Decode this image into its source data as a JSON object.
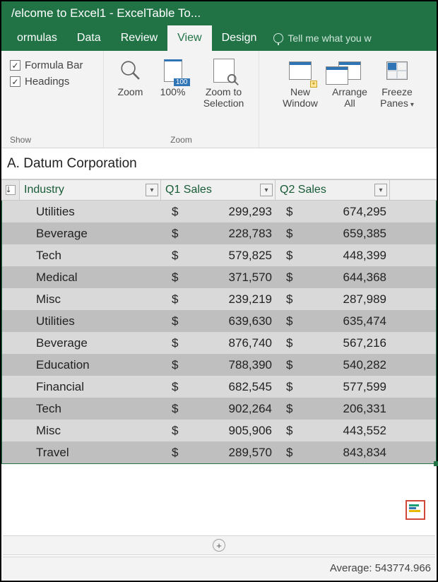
{
  "title": "/elcome to Excel1 - Excel",
  "context_tab": "Table To...",
  "tabs": {
    "formulas": "ormulas",
    "data": "Data",
    "review": "Review",
    "view": "View",
    "design": "Design"
  },
  "tellme": "Tell me what you w",
  "ribbon": {
    "show": {
      "formula_bar": "Formula Bar",
      "headings": "Headings",
      "group": "Show"
    },
    "zoom": {
      "zoom": "Zoom",
      "hundred": "100%",
      "toselection_l1": "Zoom to",
      "toselection_l2": "Selection",
      "group": "Zoom"
    },
    "window": {
      "new_l1": "New",
      "new_l2": "Window",
      "arrange_l1": "Arrange",
      "arrange_l2": "All",
      "freeze_l1": "Freeze",
      "freeze_l2": "Panes"
    }
  },
  "formula_cell": "A. Datum Corporation",
  "headers": {
    "industry": "Industry",
    "q1": "Q1 Sales",
    "q2": "Q2 Sales"
  },
  "rows": [
    {
      "industry": "Utilities",
      "q1": "299,293",
      "q2": "674,295"
    },
    {
      "industry": "Beverage",
      "q1": "228,783",
      "q2": "659,385"
    },
    {
      "industry": "Tech",
      "q1": "579,825",
      "q2": "448,399"
    },
    {
      "industry": "Medical",
      "q1": "371,570",
      "q2": "644,368"
    },
    {
      "industry": "Misc",
      "q1": "239,219",
      "q2": "287,989"
    },
    {
      "industry": "Utilities",
      "q1": "639,630",
      "q2": "635,474"
    },
    {
      "industry": "Beverage",
      "q1": "876,740",
      "q2": "567,216"
    },
    {
      "industry": "Education",
      "q1": "788,390",
      "q2": "540,282"
    },
    {
      "industry": "Financial",
      "q1": "682,545",
      "q2": "577,599"
    },
    {
      "industry": "Tech",
      "q1": "902,264",
      "q2": "206,331"
    },
    {
      "industry": "Misc",
      "q1": "905,906",
      "q2": "443,552"
    },
    {
      "industry": "Travel",
      "q1": "289,570",
      "q2": "843,834"
    }
  ],
  "currency": "$",
  "status": {
    "average_label": "Average:",
    "average_value": "543774.966"
  }
}
